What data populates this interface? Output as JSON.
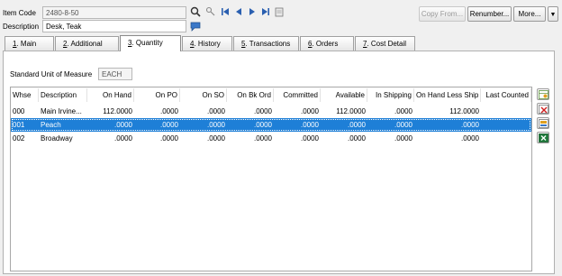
{
  "header": {
    "item_code_label": "Item Code",
    "item_code_value": "2480-8-50",
    "description_label": "Description",
    "description_value": "Desk, Teak"
  },
  "toolbar": {
    "copy_from": "Copy From...",
    "renumber": "Renumber...",
    "more": "More..."
  },
  "tabs": [
    {
      "key": "1",
      "label": ". Main"
    },
    {
      "key": "2",
      "label": ". Additional"
    },
    {
      "key": "3",
      "label": ". Quantity"
    },
    {
      "key": "4",
      "label": ". History"
    },
    {
      "key": "5",
      "label": ". Transactions"
    },
    {
      "key": "6",
      "label": ". Orders"
    },
    {
      "key": "7",
      "label": ". Cost Detail"
    }
  ],
  "quantity": {
    "uom_label": "Standard Unit of Measure",
    "uom_value": "EACH"
  },
  "grid": {
    "columns": [
      "Whse",
      "Description",
      "On Hand",
      "On PO",
      "On SO",
      "On Bk Ord",
      "Committed",
      "Available",
      "In Shipping",
      "On Hand Less Ship",
      "Last Counted"
    ],
    "rows": [
      [
        "000",
        "Main  Irvine...",
        "112.0000",
        ".0000",
        ".0000",
        ".0000",
        ".0000",
        "112.0000",
        ".0000",
        "112.0000",
        ""
      ],
      [
        "001",
        "Peach",
        ".0000",
        ".0000",
        ".0000",
        ".0000",
        ".0000",
        ".0000",
        ".0000",
        ".0000",
        ""
      ],
      [
        "002",
        "Broadway",
        ".0000",
        ".0000",
        ".0000",
        ".0000",
        ".0000",
        ".0000",
        ".0000",
        ".0000",
        ""
      ]
    ],
    "selected_row": 1
  },
  "colors": {
    "selection": "#1e7fd7",
    "nav_arrows": "#2a5fb0"
  }
}
